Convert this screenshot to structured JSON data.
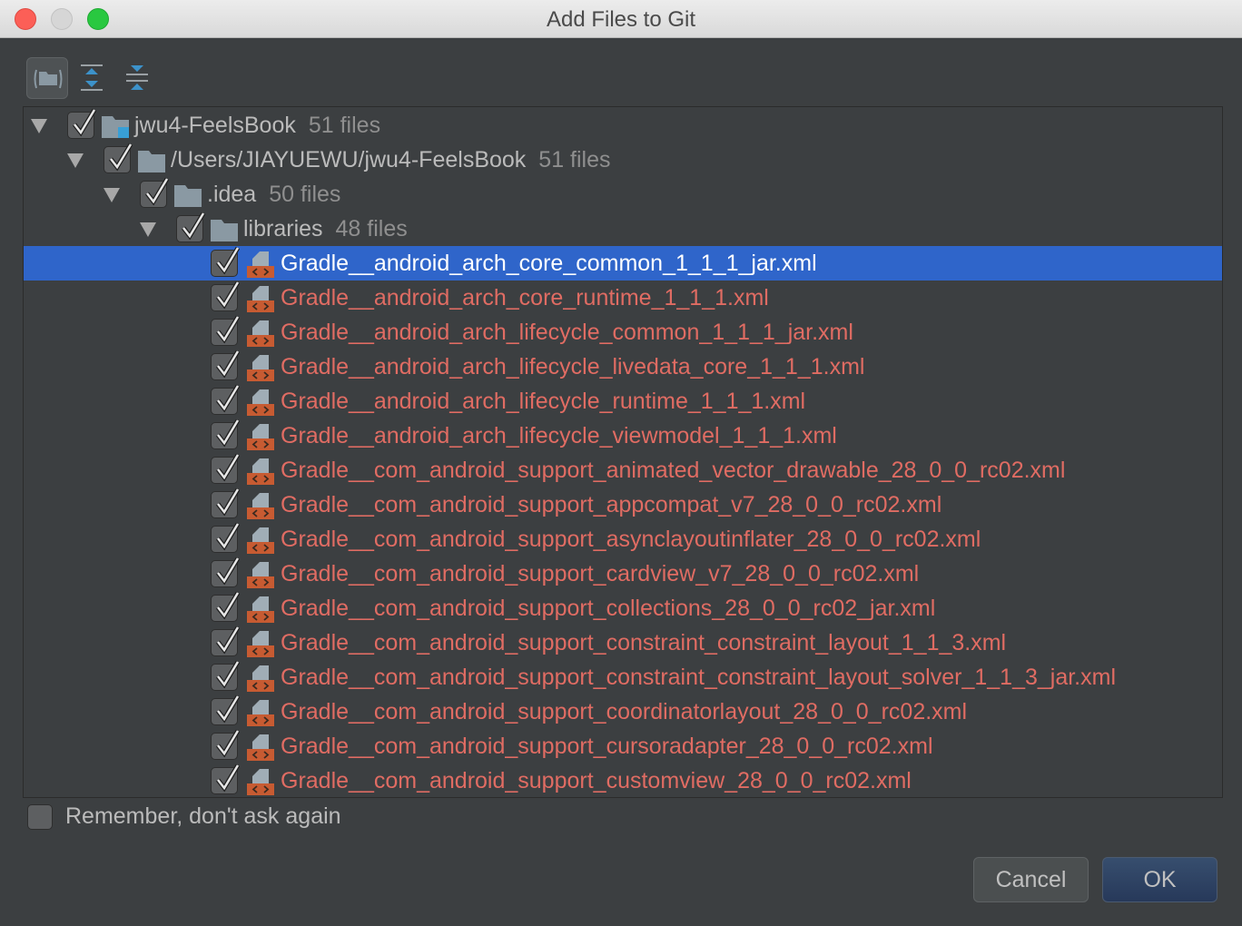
{
  "window": {
    "title": "Add Files to Git"
  },
  "toolbar": {
    "icons": [
      "group-by-directory-icon",
      "expand-all-icon",
      "collapse-all-icon"
    ]
  },
  "colors": {
    "selection": "#2f65ca",
    "unversioned_file": "#e06c63",
    "background": "#3c3f41",
    "ok_button": "#2b3e5c"
  },
  "tree": {
    "folders": [
      {
        "name": "jwu4-FeelsBook",
        "count": "51 files",
        "checked": true
      },
      {
        "name": "/Users/JIAYUEWU/jwu4-FeelsBook",
        "count": "51 files",
        "checked": true
      },
      {
        "name": ".idea",
        "count": "50 files",
        "checked": true
      },
      {
        "name": "libraries",
        "count": "48 files",
        "checked": true
      }
    ],
    "selected_index": 0,
    "files": [
      "Gradle__android_arch_core_common_1_1_1_jar.xml",
      "Gradle__android_arch_core_runtime_1_1_1.xml",
      "Gradle__android_arch_lifecycle_common_1_1_1_jar.xml",
      "Gradle__android_arch_lifecycle_livedata_core_1_1_1.xml",
      "Gradle__android_arch_lifecycle_runtime_1_1_1.xml",
      "Gradle__android_arch_lifecycle_viewmodel_1_1_1.xml",
      "Gradle__com_android_support_animated_vector_drawable_28_0_0_rc02.xml",
      "Gradle__com_android_support_appcompat_v7_28_0_0_rc02.xml",
      "Gradle__com_android_support_asynclayoutinflater_28_0_0_rc02.xml",
      "Gradle__com_android_support_cardview_v7_28_0_0_rc02.xml",
      "Gradle__com_android_support_collections_28_0_0_rc02_jar.xml",
      "Gradle__com_android_support_constraint_constraint_layout_1_1_3.xml",
      "Gradle__com_android_support_constraint_constraint_layout_solver_1_1_3_jar.xml",
      "Gradle__com_android_support_coordinatorlayout_28_0_0_rc02.xml",
      "Gradle__com_android_support_cursoradapter_28_0_0_rc02.xml",
      "Gradle__com_android_support_customview_28_0_0_rc02.xml"
    ]
  },
  "remember": {
    "label": "Remember, don't ask again",
    "checked": false
  },
  "buttons": {
    "cancel": "Cancel",
    "ok": "OK"
  }
}
